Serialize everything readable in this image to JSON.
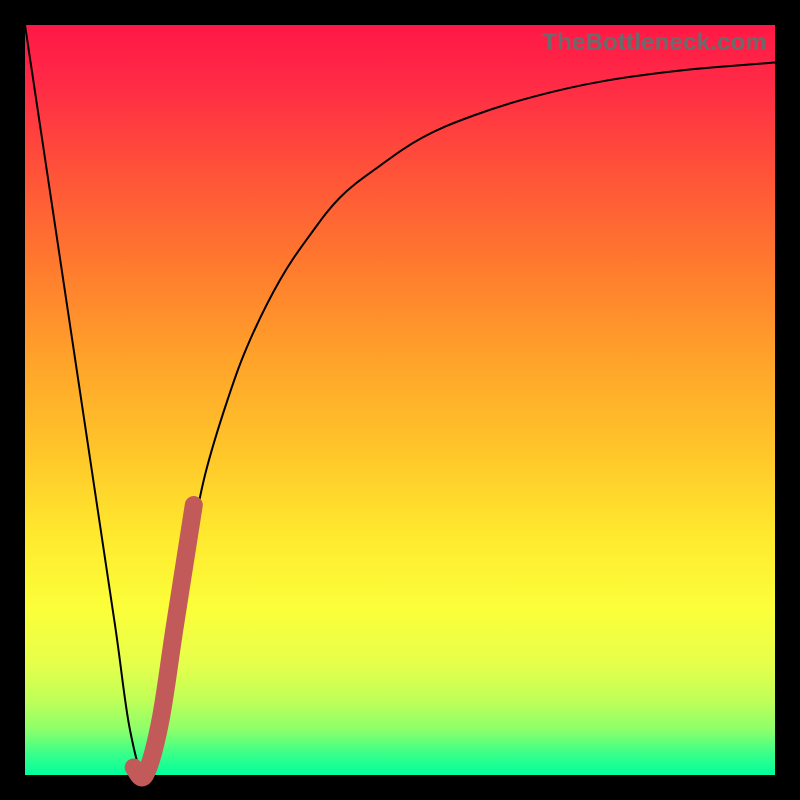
{
  "watermark": "TheBottleneck.com",
  "colors": {
    "page_bg": "#000000",
    "thin_curve": "#000000",
    "thick_segment": "#c25a5a",
    "gradient_top": "#ff1846",
    "gradient_bottom": "#00ff9c"
  },
  "chart_data": {
    "type": "line",
    "title": "",
    "xlabel": "",
    "ylabel": "",
    "xlim": [
      0,
      100
    ],
    "ylim": [
      0,
      100
    ],
    "series": [
      {
        "name": "bottleneck-curve",
        "x": [
          0,
          3,
          6,
          9,
          12,
          14,
          16,
          18,
          20,
          22,
          24,
          27,
          30,
          34,
          38,
          42,
          47,
          53,
          60,
          68,
          77,
          88,
          100
        ],
        "y": [
          100,
          80,
          60,
          40,
          20,
          6,
          0,
          6,
          18,
          30,
          40,
          50,
          58,
          66,
          72,
          77,
          81,
          85,
          88,
          90.5,
          92.5,
          94,
          95
        ]
      },
      {
        "name": "highlight-segment",
        "x": [
          14.5,
          16,
          18,
          20,
          22.5
        ],
        "y": [
          1,
          0,
          7,
          20,
          36
        ]
      }
    ],
    "notes": "Values are read in percent of plot area (origin at bottom-left). No axis ticks are visible in the source image; numbers estimated from curve geometry."
  }
}
